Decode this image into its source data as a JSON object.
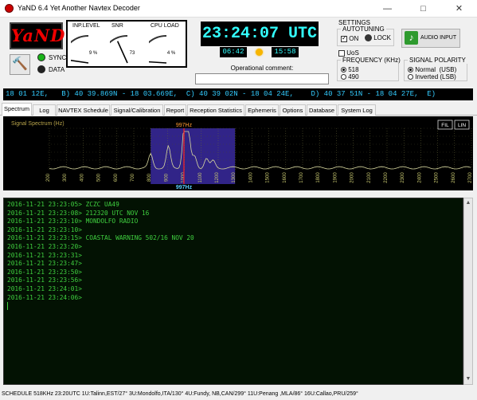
{
  "window": {
    "title": "YaND 6.4 Yet Another Navtex Decoder"
  },
  "logo": {
    "text": "YaND"
  },
  "indicators": {
    "sync_label": "SYNC",
    "data_label": "DATA",
    "sync_color": "#1bb51b",
    "data_color": "#222222"
  },
  "gauges": [
    {
      "label": "INP.LEVEL",
      "value": "9 %",
      "level": 0.09
    },
    {
      "label": "SNR",
      "value": "73",
      "level": 0.73
    },
    {
      "label": "CPU LOAD",
      "value": "4 %",
      "level": 0.04
    }
  ],
  "clock": {
    "utc": "23:24:07 UTC",
    "sunrise": "06:42",
    "sunset": "15:58",
    "op_comment_label": "Operational comment:",
    "op_comment_value": ""
  },
  "settings": {
    "title": "SETTINGS",
    "autotuning": {
      "title": "AUTOTUNING",
      "on_label": "ON",
      "on_checked": true,
      "lock_label": "LOCK"
    },
    "audio_input_label": "AUDIO INPUT",
    "uos_label": "UoS",
    "uos_checked": false,
    "frequency": {
      "title": "FREQUENCY (KHz)",
      "options": [
        "518",
        "490"
      ],
      "selected": "518"
    },
    "polarity": {
      "title": "SIGNAL POLARITY",
      "options": [
        "Normal  (USB)",
        "Inverted (LSB)"
      ],
      "selected": "Normal  (USB)"
    }
  },
  "ticker": "18 01 12E,   B) 40 39.869N - 18 03.669E,  C) 40 39 02N - 18 04 24E,    D) 40 37 51N - 18 04 27E,  E)",
  "tabs": [
    "Spectrum",
    "Log",
    "NAVTEX Schedule",
    "Signal/Calibration",
    "Report",
    "Reception Statistics",
    "Ephemeris",
    "Options",
    "Database",
    "System Log"
  ],
  "active_tab": "Spectrum",
  "spectrum": {
    "label": "Signal Spectrum (Hz)",
    "btn_fil": "FIL",
    "btn_lin": "LIN",
    "marker_top": "997Hz",
    "marker_bottom": "997Hz",
    "ticks": [
      "200",
      "300",
      "400",
      "500",
      "600",
      "700",
      "800",
      "900",
      "1000",
      "1100",
      "1200",
      "1300",
      "1400",
      "1500",
      "1600",
      "1700",
      "1800",
      "1900",
      "2000",
      "2100",
      "2200",
      "2300",
      "2400",
      "2500",
      "2600",
      "2700"
    ],
    "passband": [
      800,
      1300
    ],
    "marker_freq": 997,
    "peaks": [
      [
        800,
        0.35
      ],
      [
        905,
        0.55
      ],
      [
        997,
        0.4
      ],
      [
        1005,
        0.95
      ],
      [
        1025,
        0.75
      ],
      [
        1060,
        0.3
      ],
      [
        1130,
        0.25
      ],
      [
        1170,
        0.18
      ]
    ]
  },
  "log_lines": [
    "2016-11-21 23:23:05> ZCZC UA49",
    "2016-11-21 23:23:08> 212320 UTC NOV 16",
    "2016-11-21 23:23:10> MONDOLFO RADIO",
    "2016-11-21 23:23:10>",
    "2016-11-21 23:23:15> COASTAL WARNING 502/16 NOV 20",
    "2016-11-21 23:23:20>",
    "2016-11-21 23:23:31>",
    "2016-11-21 23:23:47>",
    "2016-11-21 23:23:50>",
    "2016-11-21 23:23:56>",
    "2016-11-21 23:24:01>",
    "2016-11-21 23:24:06>"
  ],
  "status": "SCHEDULE 518KHz 23:20UTC 1U:Talinn,EST/27° 3U:Mondolfo,ITA/130° 4U:Fundy, NB,CAN/299° 11U:Penang ,MLA/86° 16U:Callao,PRU/259°"
}
